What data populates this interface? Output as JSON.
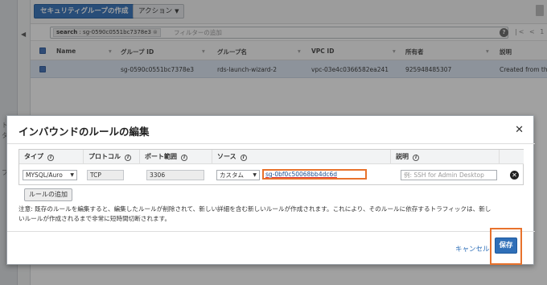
{
  "toolbar": {
    "create_label": "セキュリティグループの作成",
    "action_label": "アクション"
  },
  "search": {
    "chip_key": "search",
    "chip_value": "sg-0590c0551bc7378e3",
    "placeholder": "フィルターの追加"
  },
  "pager": "|< < 1",
  "table": {
    "headers": [
      "Name",
      "グループ ID",
      "グループ名",
      "VPC ID",
      "所有者",
      "説明"
    ],
    "row": {
      "name": "",
      "group_id": "sg-0590c0551bc7378e3",
      "group_name": "rds-launch-wizard-2",
      "vpc_id": "vpc-03e4c0366582ea241",
      "owner": "925948485307",
      "description": "Created from the"
    }
  },
  "leftbar_fragments": [
    "ト",
    "タ",
    "プ"
  ],
  "modal": {
    "title": "インバウンドのルールの編集",
    "columns": {
      "type": "タイプ",
      "protocol": "プロトコル",
      "port": "ポート範囲",
      "source": "ソース",
      "description": "説明"
    },
    "rule": {
      "type": "MYSQL/Auro",
      "protocol": "TCP",
      "port": "3306",
      "source_mode": "カスタム",
      "source_value": "sg-0bf0c50068bb4dc6d",
      "description_placeholder": "例: SSH for Admin Desktop"
    },
    "add_rule_label": "ルールの追加",
    "note": "注意: 既存のルールを編集すると、編集したルールが削除されて、新しい詳細を含む新しいルールが作成されます。これにより、そのルールに依存するトラフィックは、新しいルールが作成されるまで非常に短時間切断されます。",
    "cancel_label": "キャンセル",
    "save_label": "保存"
  },
  "colors": {
    "primary": "#2f6fb8",
    "highlight": "#e8722c",
    "selected_row": "#dce7f5"
  }
}
